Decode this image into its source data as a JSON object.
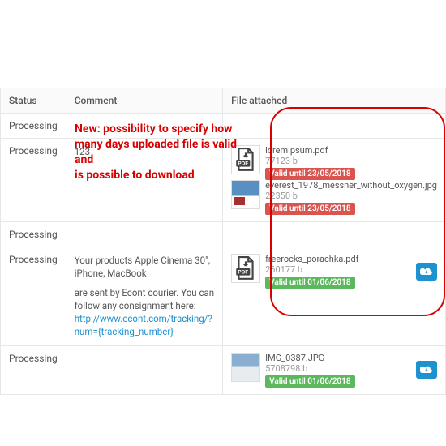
{
  "headers": {
    "status": "Status",
    "comment": "Comment",
    "file": "File attached"
  },
  "annotation": "New: possibility to specify how many days uploaded file is valid and\nis possible to download",
  "rows": [
    {
      "status": "Processing",
      "comment_plain": "",
      "files": []
    },
    {
      "status": "Processing",
      "comment_plain": "123",
      "files": [
        {
          "name": "loremipsum.pdf",
          "size": "77123 b",
          "badge": "Valid until 23/05/2018",
          "badge_color": "red",
          "icon": "pdf",
          "dl": false
        },
        {
          "name": "everest_1978_messner_without_oxygen.jpg",
          "size": "22350 b",
          "badge": "Valid until 23/05/2018",
          "badge_color": "red",
          "icon": "img-everest",
          "dl": false
        }
      ]
    },
    {
      "status": "Processing",
      "comment_plain": "",
      "files": []
    },
    {
      "status": "Processing",
      "comment_html": true,
      "comment_pre": "Your products Apple Cinema 30\", iPhone, MacBook",
      "comment_mid": "are sent by Econt courier. You can follow any consignment here: ",
      "comment_link": "http://www.econt.com/tracking/?num={tracking_number}",
      "files": [
        {
          "name": "freerocks_porachka.pdf",
          "size": "260177 b",
          "badge": "Valid until 01/06/2018",
          "badge_color": "green",
          "icon": "pdf",
          "dl": true
        }
      ]
    },
    {
      "status": "Processing",
      "comment_plain": "",
      "files": [
        {
          "name": "IMG_0387.JPG",
          "size": "5708798 b",
          "badge": "Valid until 01/06/2018",
          "badge_color": "green",
          "icon": "img-generic",
          "dl": true
        }
      ]
    }
  ]
}
